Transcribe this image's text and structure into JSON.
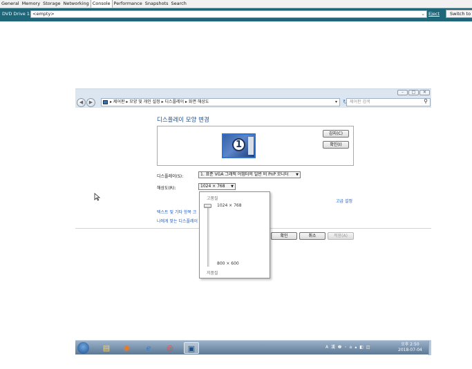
{
  "vm_tabs": [
    "General",
    "Memory",
    "Storage",
    "Networking",
    "Console",
    "Performance",
    "Snapshots",
    "Search"
  ],
  "active_tab_index": 4,
  "dvd": {
    "label": "DVD Drive 1:",
    "value": "<empty>",
    "eject": "Eject",
    "switch": "Switch to"
  },
  "window": {
    "breadcrumb": "▸ 제어판 ▸ 모양 및 개인 설정 ▸ 디스플레이 ▸ 화면 해상도",
    "search_placeholder": "제어판 검색",
    "heading": "디스플레이 모양 변경",
    "monitor_number": "1",
    "detect_button": "감지(C)",
    "identify_button": "확인(I)",
    "display_label": "디스플레이(S):",
    "display_value": "1. 표준 VGA 그래픽 어댑터의 일반 비 PnP 모니터",
    "resolution_label": "해상도(R):",
    "resolution_value": "1024 × 768",
    "advanced_link": "고급 설정",
    "link_text_size": "텍스트 및 기타 항목 크",
    "link_display_settings": "나에게 맞는 디스플레이",
    "ok_button": "확인",
    "cancel_button": "취소",
    "apply_button": "적용(A)"
  },
  "resolution_popup": {
    "high_label": "고품질",
    "top_value": "1024 × 768",
    "bottom_value": "800 × 600",
    "low_label": "저품질",
    "slider_position": 1.0
  },
  "taskbar": {
    "tray_text": "A 漢 ❷ ◦ ⌂ ▴ ◧ ◫",
    "time": "오후 2:50",
    "date": "2018-07-04"
  }
}
